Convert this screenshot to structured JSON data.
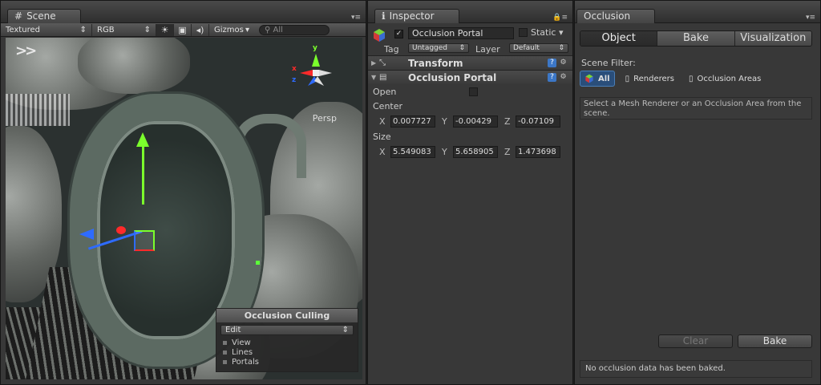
{
  "scene": {
    "tab": "Scene",
    "render_mode": "Textured",
    "color_mode": "RGB",
    "gizmos": "Gizmos",
    "search_placeholder": "All",
    "view_label": "Persp",
    "axis_y": "y",
    "axis_x": "x",
    "axis_z": "z",
    "overlay": {
      "title": "Occlusion Culling",
      "mode": "Edit",
      "items": [
        "View",
        "Lines",
        "Portals"
      ]
    }
  },
  "inspector": {
    "tab": "Inspector",
    "object_name": "Occlusion Portal",
    "static_label": "Static",
    "tag_label": "Tag",
    "tag_value": "Untagged",
    "layer_label": "Layer",
    "layer_value": "Default",
    "components": {
      "transform": "Transform",
      "portal": "Occlusion Portal"
    },
    "open_label": "Open",
    "center_label": "Center",
    "center": {
      "x": "0.007727",
      "y": "-0.00429",
      "z": "-0.07109"
    },
    "size_label": "Size",
    "size": {
      "x": "5.549083",
      "y": "5.658905",
      "z": "1.473698"
    }
  },
  "occlusion": {
    "tab": "Occlusion",
    "tabs": [
      "Object",
      "Bake",
      "Visualization"
    ],
    "active_tab": "Object",
    "scene_filter_label": "Scene Filter:",
    "filters": [
      "All",
      "Renderers",
      "Occlusion Areas"
    ],
    "help": "Select a Mesh Renderer or an Occlusion Area from the scene.",
    "clear_label": "Clear",
    "bake_label": "Bake",
    "status": "No occlusion data has been baked."
  },
  "colors": {
    "gizmo_y": "#7bff2c",
    "gizmo_x": "#2e6bff",
    "gizmo_z": "#ff2a2a",
    "filter_active": "#2a4e7a"
  }
}
